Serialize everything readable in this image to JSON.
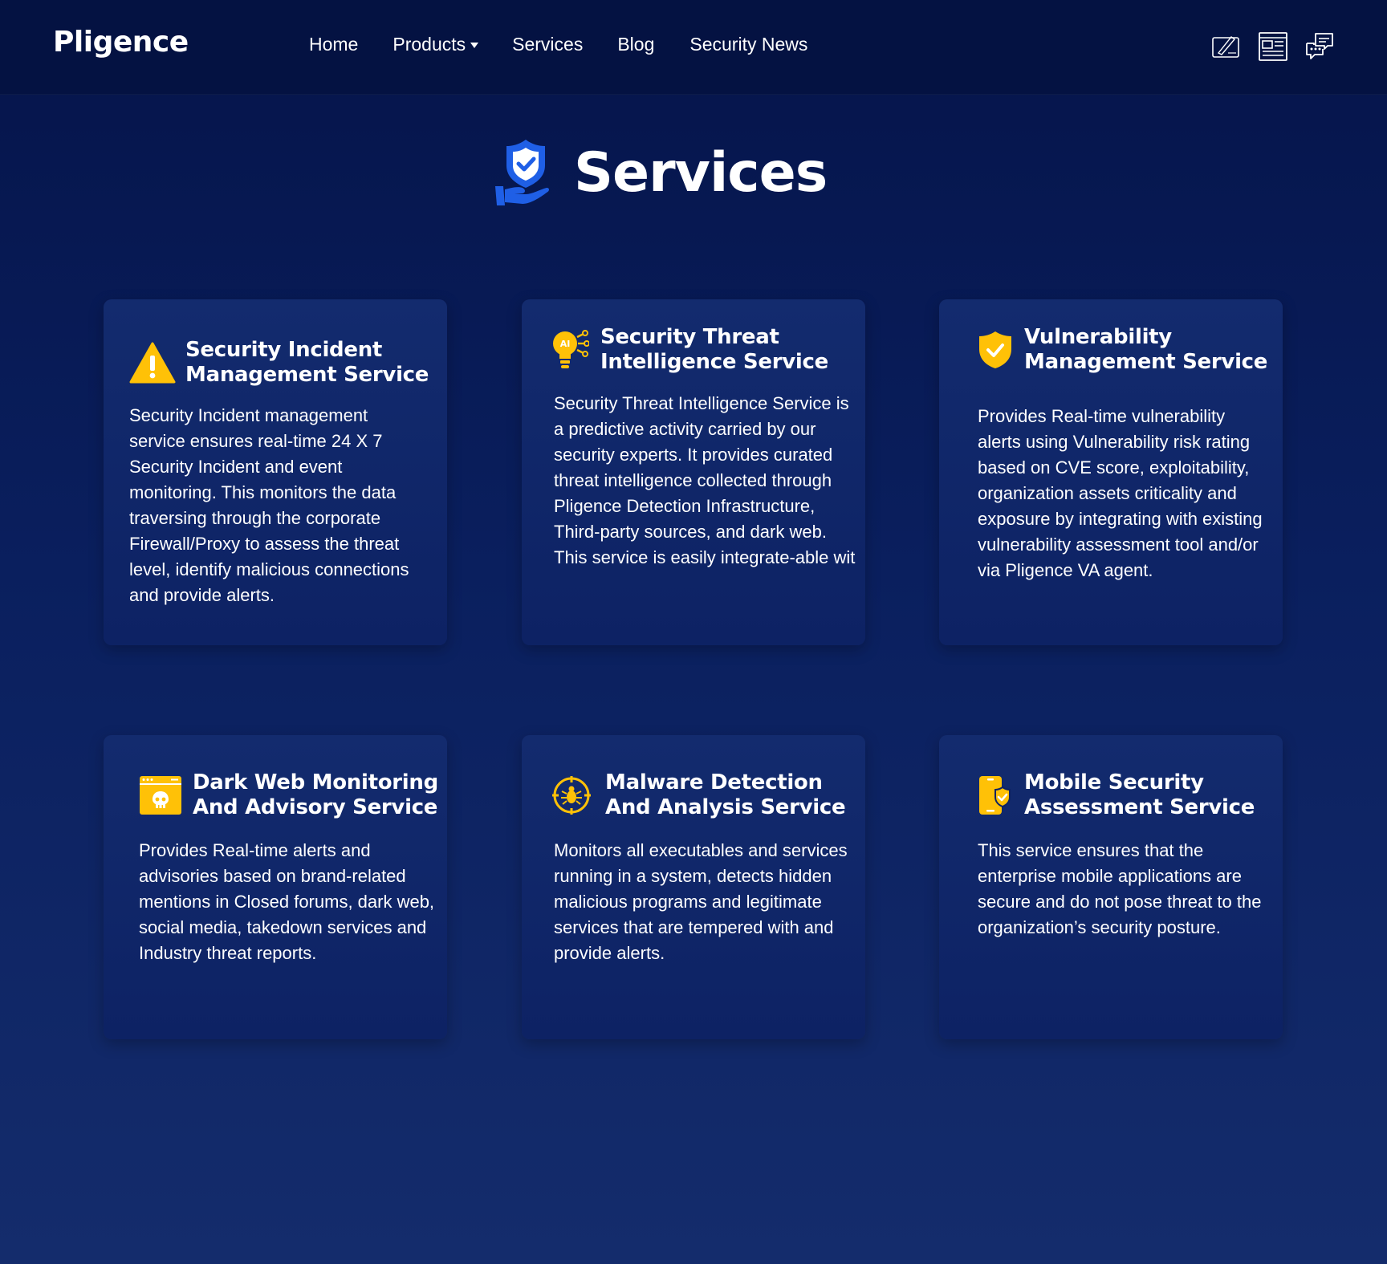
{
  "brand": {
    "logo_text": "Pligence"
  },
  "nav": {
    "items": [
      {
        "label": "Home"
      },
      {
        "label": "Products"
      },
      {
        "label": "Services"
      },
      {
        "label": "Blog"
      },
      {
        "label": "Security News"
      }
    ]
  },
  "top_icons": [
    "blog-icon",
    "security-news-icon",
    "chat-icon"
  ],
  "hero": {
    "title": "Services",
    "icon": "shield-hand-icon"
  },
  "colors": {
    "accent": "#ffc107",
    "background": "#05144a",
    "card": "#132b6e"
  },
  "services": [
    {
      "icon": "warning-triangle-icon",
      "title_line1": "Security Incident",
      "title_line2": "Management Service",
      "body": "Security Incident management service ensures real-time 24 X 7 Security Incident and event monitoring. This monitors the data traversing through the corporate Firewall/Proxy to assess the threat level, identify malicious connections and provide alerts."
    },
    {
      "icon": "ai-bulb-icon",
      "title_line1": "Security Threat",
      "title_line2": "Intelligence Service",
      "body": "Security Threat Intelligence Service is a predictive activity carried by our security experts. It provides curated threat intelligence collected through Pligence Detection Infrastructure, Third-party sources, and dark web. This service is easily integrate-able wit"
    },
    {
      "icon": "shield-check-icon",
      "title_line1": "Vulnerability",
      "title_line2": "Management Service",
      "body": "Provides Real-time vulnerability alerts using Vulnerability risk rating based on CVE score, exploitability, organization assets criticality and exposure by integrating with existing vulnerability assessment tool and/or via Pligence VA agent."
    },
    {
      "icon": "skull-browser-icon",
      "title_line1": "Dark Web Monitoring",
      "title_line2": "And Advisory Service",
      "body": "Provides Real-time alerts and advisories based on brand-related mentions in Closed forums, dark web, social media, takedown services and Industry threat reports."
    },
    {
      "icon": "bug-target-icon",
      "title_line1": "Malware Detection",
      "title_line2": "And Analysis Service",
      "body": "Monitors all executables and services running in a system, detects hidden malicious programs and legitimate services that are tempered with and provide alerts."
    },
    {
      "icon": "mobile-shield-icon",
      "title_line1": "Mobile Security",
      "title_line2": "Assessment Service",
      "body": "This service ensures that the enterprise mobile applications are secure and do not pose threat to the organization’s security posture."
    }
  ]
}
